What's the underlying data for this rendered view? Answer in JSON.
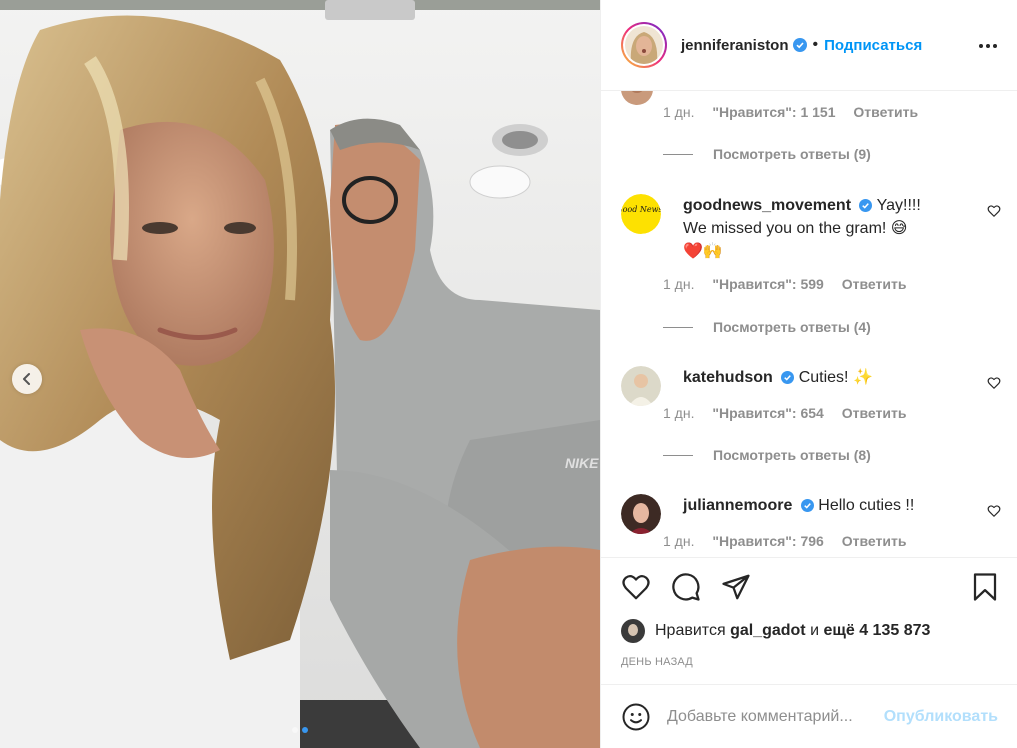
{
  "post": {
    "username": "jenniferaniston",
    "follow_label": "Подписаться",
    "separator": "•",
    "icons": {
      "more": "more-icon",
      "verified": "verified-badge-icon",
      "prev": "chevron-left-icon"
    }
  },
  "comments_partial": {
    "time": "1 дн.",
    "likes": "\"Нравится\": 1 151",
    "reply": "Ответить",
    "view_replies": "Посмотреть ответы (9)"
  },
  "comments": [
    {
      "username": "goodnews_movement",
      "avatar_text": "Good News!",
      "text_line1": "Yay!!!!",
      "text_line2": "We missed you on the gram! 😅",
      "text_line3": "❤️🙌",
      "time": "1 дн.",
      "likes": "\"Нравится\": 599",
      "reply": "Ответить",
      "view_replies": "Посмотреть ответы (4)"
    },
    {
      "username": "katehudson",
      "text": "Cuties! ✨",
      "time": "1 дн.",
      "likes": "\"Нравится\": 654",
      "reply": "Ответить",
      "view_replies": "Посмотреть ответы (8)"
    },
    {
      "username": "juliannemoore",
      "text": "Hello cuties !!",
      "time": "1 дн.",
      "likes": "\"Нравится\": 796",
      "reply": "Ответить"
    }
  ],
  "actions": {
    "icons": [
      "heart-icon",
      "comment-icon",
      "share-icon",
      "bookmark-icon"
    ],
    "liked_by_prefix": "Нравится",
    "liked_by_user": "gal_gadot",
    "liked_by_connector": "и",
    "liked_by_rest": "ещё 4 135 873",
    "time_ago": "ДЕНЬ НАЗАД"
  },
  "add_comment": {
    "placeholder": "Добавьте комментарий...",
    "publish_label": "Опубликовать"
  },
  "carousel": {
    "total": 2,
    "active": 2
  },
  "colors": {
    "accent": "#0095f6",
    "muted": "#8e8e8e",
    "text": "#262626",
    "publish_disabled": "#b2dffc",
    "like_red": "#ed4956"
  }
}
